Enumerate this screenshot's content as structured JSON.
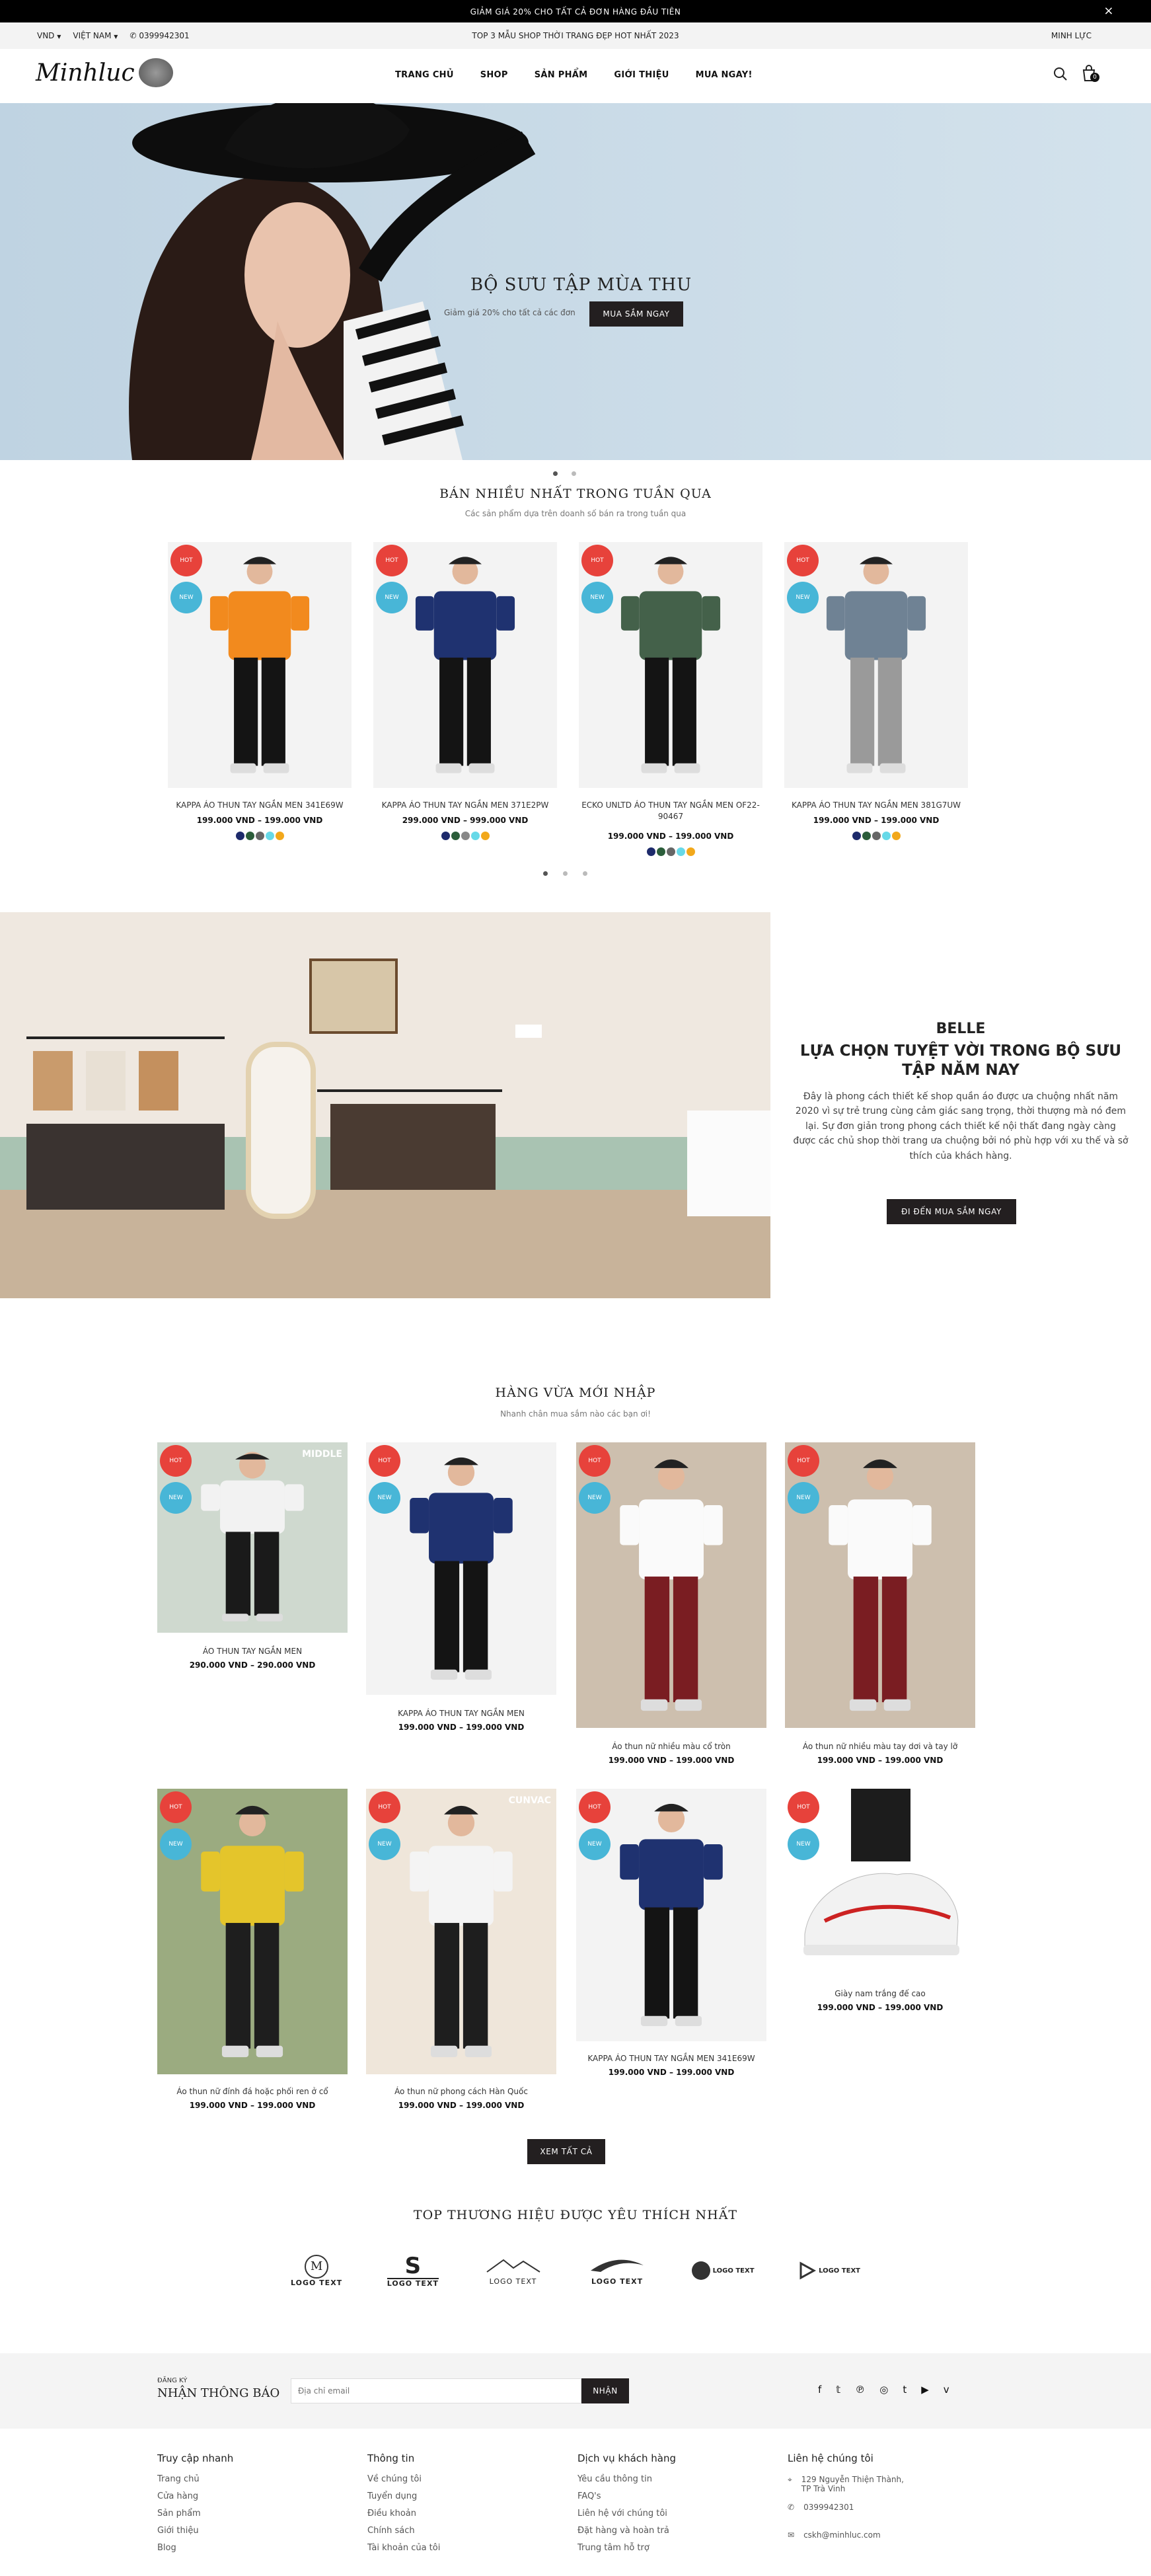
{
  "announcement": {
    "text": "GIẢM GIÁ 20% CHO TẤT CẢ ĐƠN HÀNG ĐẦU TIÊN",
    "close": "×"
  },
  "subbar": {
    "currency": "VND",
    "country": "VIỆT NAM",
    "phone": "0399942301",
    "promo": "TOP 3 MẪU SHOP THỜI TRANG ĐẸP HOT NHẤT 2023",
    "user": "MINH LỰC"
  },
  "header": {
    "logo": "Minhluc",
    "nav": [
      "TRANG CHỦ",
      "SHOP",
      "SẢN PHẨM",
      "GIỚI THIỆU",
      "MUA NGAY!"
    ],
    "cart_count": "0"
  },
  "hero": {
    "title": "BỘ SƯU TẬP MÙA THU",
    "subtitle": "Giảm giá 20% cho tất cả các đơn",
    "button": "MUA SẮM NGAY"
  },
  "best": {
    "title": "BÁN NHIỀU NHẤT TRONG TUẦN QUA",
    "subtitle": "Các sản phẩm dựa trên doanh số bán ra trong tuần qua",
    "products": [
      {
        "name": "KAPPA ÁO THUN TAY NGẮN MEN 341E69W",
        "price": "199.000 VND – 199.000 VND",
        "hot": "HOT",
        "new": "NEW",
        "shirt": "#f28a1e",
        "pants": "#141414",
        "swatches": [
          "#1d2a6b",
          "#2b5d3a",
          "#666",
          "#67d9e8",
          "#f2a81b"
        ]
      },
      {
        "name": "KAPPA ÁO THUN TAY NGẮN MEN 371E2PW",
        "price": "299.000 VND – 999.000 VND",
        "hot": "HOT",
        "new": "NEW",
        "shirt": "#1f3270",
        "pants": "#141414",
        "swatches": [
          "#1d2a6b",
          "#2b5d3a",
          "#888",
          "#67d9e8",
          "#f2a81b"
        ]
      },
      {
        "name": "ECKO UNLTD ÁO THUN TAY NGẮN MEN OF22-90467",
        "price": "199.000 VND – 199.000 VND",
        "hot": "HOT",
        "new": "NEW",
        "shirt": "#44614a",
        "pants": "#141414",
        "swatches": [
          "#1d2a6b",
          "#2b5d3a",
          "#666",
          "#67d9e8",
          "#f2a81b"
        ]
      },
      {
        "name": "KAPPA ÁO THUN TAY NGẮN MEN 381G7UW",
        "price": "199.000 VND – 199.000 VND",
        "hot": "HOT",
        "new": "NEW",
        "shirt": "#6f8294",
        "pants": "#9a9a9a",
        "swatches": [
          "#1d2a6b",
          "#2b5d3a",
          "#666",
          "#67d9e8",
          "#f2a81b"
        ]
      }
    ]
  },
  "promo": {
    "brand": "BELLE",
    "title": "LỰA CHỌN TUYỆT VỜI TRONG BỘ SƯU TẬP NĂM NAY",
    "body": "Đây là phong cách thiết kế shop quần áo được ưa chuộng nhất năm 2020 vì sự trẻ trung cùng cảm giác sang trọng, thời thượng mà nó đem lại. Sự đơn giản trong phong cách thiết kế nội thất đang ngày càng được các chủ shop thời trang ưa chuộng bởi nó phù hợp với xu thế và sở thích của khách hàng.",
    "button": "ĐI ĐẾN MUA SẮM NGAY",
    "poster": "Moni"
  },
  "arrivals": {
    "title": "HÀNG VỪA MỚI NHẬP",
    "subtitle": "Nhanh chân mua sắm nào các bạn ơi!",
    "button": "XEM TẤT CẢ",
    "products": [
      {
        "name": "ÁO THUN TAY NGẮN MEN",
        "price": "290.000 VND – 290.000 VND",
        "hot": "HOT",
        "new": "NEW",
        "tag": "MIDDLE"
      },
      {
        "name": "KAPPA ÁO THUN TAY NGẮN MEN",
        "price": "199.000 VND – 199.000 VND",
        "hot": "HOT",
        "new": "NEW",
        "tag": ""
      },
      {
        "name": "Áo thun nữ nhiều màu cổ tròn",
        "price": "199.000 VND – 199.000 VND",
        "hot": "HOT",
        "new": "NEW",
        "tag": ""
      },
      {
        "name": "Áo thun nữ nhiều màu tay dơi và tay lỡ",
        "price": "199.000 VND – 199.000 VND",
        "hot": "HOT",
        "new": "NEW",
        "tag": ""
      },
      {
        "name": "Áo thun nữ đính đá hoặc phối ren ở cổ",
        "price": "199.000 VND – 199.000 VND",
        "hot": "HOT",
        "new": "NEW",
        "tag": ""
      },
      {
        "name": "Áo thun nữ phong cách Hàn Quốc",
        "price": "199.000 VND – 199.000 VND",
        "hot": "HOT",
        "new": "NEW",
        "tag": "CUNVAC"
      },
      {
        "name": "KAPPA ÁO THUN TAY NGẮN MEN 341E69W",
        "price": "199.000 VND – 199.000 VND",
        "hot": "HOT",
        "new": "NEW",
        "tag": ""
      },
      {
        "name": "Giày nam trắng đế cao",
        "price": "199.000 VND – 199.000 VND",
        "hot": "HOT",
        "new": "NEW",
        "tag": ""
      }
    ]
  },
  "brands": {
    "title": "TOP THƯƠNG HIỆU ĐƯỢC YÊU THÍCH NHẤT",
    "logo_text": "LOGO TEXT"
  },
  "newsletter": {
    "small": "ĐĂNG KÝ",
    "title": "NHẬN THÔNG BÁO",
    "placeholder": "Địa chỉ email",
    "button": "NHẬN"
  },
  "footer": {
    "cols": [
      {
        "title": "Truy cập nhanh",
        "items": [
          "Trang chủ",
          "Cửa hàng",
          "Sản phẩm",
          "Giới thiệu",
          "Blog"
        ]
      },
      {
        "title": "Thông tin",
        "items": [
          "Về chúng tôi",
          "Tuyển dụng",
          "Điều khoản",
          "Chính sách",
          "Tài khoản của tôi"
        ]
      },
      {
        "title": "Dịch vụ khách hàng",
        "items": [
          "Yêu cầu thông tin",
          "FAQ's",
          "Liên hệ với chúng tôi",
          "Đặt hàng và hoàn trả",
          "Trung tâm hỗ trợ"
        ]
      }
    ],
    "contact": {
      "title": "Liên hệ chúng tôi",
      "address1": "129 Nguyễn Thiện Thành,",
      "address2": "TP Trà Vinh",
      "phone": "0399942301",
      "email": "cskh@minhluc.com"
    }
  }
}
